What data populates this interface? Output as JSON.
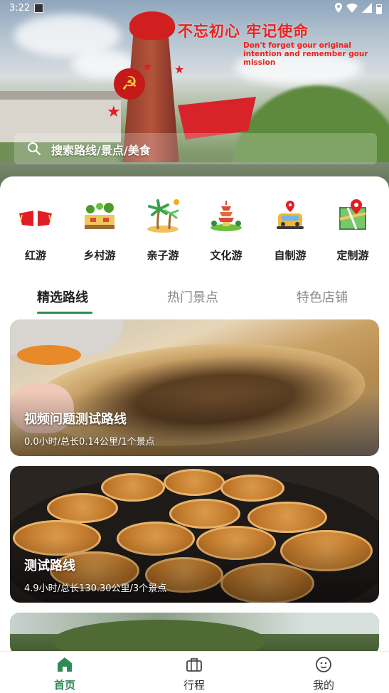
{
  "status_bar": {
    "time": "3:22"
  },
  "hero": {
    "slogan": "不忘初心 牢记使命",
    "slogan_en": "Don't forget gour original intention and remember gour mission"
  },
  "search": {
    "placeholder": "搜索路线/景点/美食"
  },
  "categories": [
    {
      "label": "红游",
      "icon": "red-flags-icon"
    },
    {
      "label": "乡村游",
      "icon": "village-icon"
    },
    {
      "label": "亲子游",
      "icon": "palm-tree-icon"
    },
    {
      "label": "文化游",
      "icon": "pagoda-icon"
    },
    {
      "label": "自制游",
      "icon": "car-pin-icon"
    },
    {
      "label": "定制游",
      "icon": "map-pin-icon"
    }
  ],
  "tabs": [
    {
      "label": "精选路线",
      "active": true
    },
    {
      "label": "热门景点",
      "active": false
    },
    {
      "label": "特色店铺",
      "active": false
    }
  ],
  "routes": [
    {
      "title": "视频问题测试路线",
      "meta": "0.0小时/总长0.14公里/1个景点"
    },
    {
      "title": "测试路线",
      "meta": "4.9小时/总长130.30公里/3个景点"
    }
  ],
  "bottom_nav": [
    {
      "label": "首页",
      "icon": "home-icon",
      "active": true
    },
    {
      "label": "行程",
      "icon": "briefcase-icon",
      "active": false
    },
    {
      "label": "我的",
      "icon": "face-icon",
      "active": false
    }
  ],
  "colors": {
    "accent": "#2e8b57",
    "red": "#e01e24"
  }
}
